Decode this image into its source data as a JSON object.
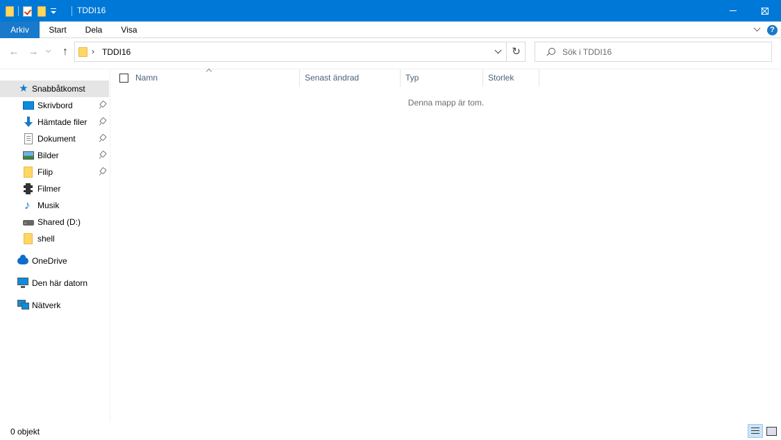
{
  "window": {
    "title": "TDDI16",
    "controls": {
      "minimize": "minimize",
      "maximize": "maximize",
      "close": "close"
    }
  },
  "ribbon": {
    "tabs": [
      {
        "label": "Arkiv"
      },
      {
        "label": "Start"
      },
      {
        "label": "Dela"
      },
      {
        "label": "Visa"
      }
    ],
    "help": "?"
  },
  "address": {
    "separator": "›",
    "path": "TDDI16",
    "refresh_glyph": "↻"
  },
  "nav": {
    "back_glyph": "←",
    "forward_glyph": "→",
    "up_glyph": "↑"
  },
  "search": {
    "placeholder": "Sök i TDDI16"
  },
  "sidebar": {
    "quick_access": "Snabbåtkomst",
    "items": [
      {
        "label": "Skrivbord",
        "icon": "desktop-icon",
        "pinned": true
      },
      {
        "label": "Hämtade filer",
        "icon": "download-icon",
        "pinned": true
      },
      {
        "label": "Dokument",
        "icon": "document-icon",
        "pinned": true
      },
      {
        "label": "Bilder",
        "icon": "pictures-icon",
        "pinned": true
      },
      {
        "label": "Filip",
        "icon": "folder-icon",
        "pinned": true
      },
      {
        "label": "Filmer",
        "icon": "video-icon",
        "pinned": false
      },
      {
        "label": "Musik",
        "icon": "music-icon",
        "pinned": false
      },
      {
        "label": "Shared (D:)",
        "icon": "drive-icon",
        "pinned": false
      },
      {
        "label": "shell",
        "icon": "folder-icon",
        "pinned": false
      }
    ],
    "onedrive": "OneDrive",
    "this_pc": "Den här datorn",
    "network": "Nätverk"
  },
  "columns": {
    "name": "Namn",
    "modified": "Senast ändrad",
    "type": "Typ",
    "size": "Storlek"
  },
  "content": {
    "empty_message": "Denna mapp är tom."
  },
  "status": {
    "item_count": "0 objekt"
  },
  "colors": {
    "titlebar": "#0078d7",
    "file_tab": "#1979ca",
    "selection": "#e5e5e5",
    "folder": "#ffd763"
  }
}
